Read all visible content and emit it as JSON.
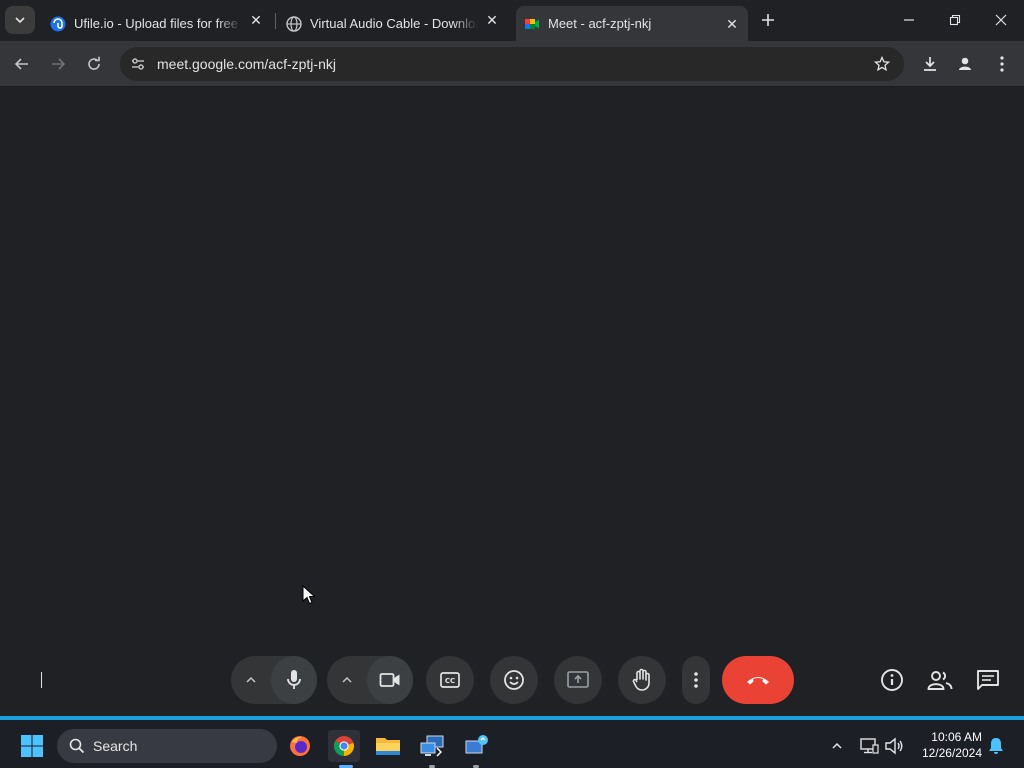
{
  "browser": {
    "tabs": [
      {
        "title": "Ufile.io - Upload files for free &",
        "icon": "ufile-icon"
      },
      {
        "title": "Virtual Audio Cable - Download",
        "icon": "globe-icon"
      },
      {
        "title": "Meet - acf-zptj-nkj",
        "icon": "meet-icon",
        "active": true
      }
    ],
    "url": "meet.google.com/acf-zptj-nkj"
  },
  "meet": {
    "controls": [
      "mic-chevron",
      "mic",
      "camera-chevron",
      "camera",
      "captions",
      "emoji",
      "present",
      "raise-hand",
      "more-options",
      "end-call",
      "info",
      "people",
      "chat"
    ],
    "end_call_color": "#ea4335"
  },
  "taskbar": {
    "search_label": "Search",
    "time": "10:06 AM",
    "date": "12/26/2024",
    "accent": "#1a9fd8"
  }
}
